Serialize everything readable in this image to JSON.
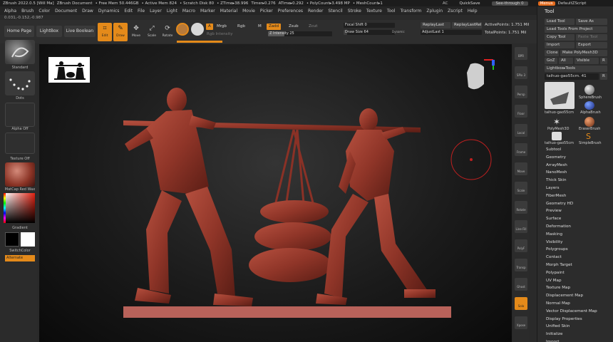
{
  "status_bar": {
    "app": "ZBrush 2022.0.5 [Will Ma]",
    "document": "ZBrush Document",
    "free_mem": "• Free Mem 50.446GB",
    "active_mem": "• Active Mem 824",
    "scratch_disk": "• Scratch Disk 80",
    "ztime": "• ZTime▸38.996",
    "timer": "Timer▸0.276",
    "atime": "ATime▸0.292",
    "polycount": "• PolyCount▸3.498 MP",
    "meshcount": "• MeshCount▸1",
    "ac": "AC",
    "quicksave": "QuickSave",
    "see_through": "See-through 0",
    "menus": "Menus",
    "default_zscript": "DefaultZScript"
  },
  "menu_bar": [
    "Alpha",
    "Brush",
    "Color",
    "Document",
    "Draw",
    "Dynamics",
    "Edit",
    "File",
    "Layer",
    "Light",
    "Macro",
    "Marker",
    "Material",
    "Movie",
    "Picker",
    "Preferences",
    "Render",
    "Stencil",
    "Stroke",
    "Texture",
    "Tool",
    "Transform",
    "Zplugin",
    "Zscript",
    "Help"
  ],
  "coords": "0.031,-0.152,-0.987",
  "toolbar": {
    "home_page": "Home Page",
    "lightbox": "LightBox",
    "live_boolean": "Live Boolean",
    "edit": "Edit",
    "draw": "Draw",
    "move": "Move",
    "scale": "Scale",
    "rotate": "Rotate",
    "a": "A",
    "mrgb": "Mrgb",
    "rgb": "Rgb",
    "m": "M",
    "zadd": "Zadd",
    "zsub": "Zsub",
    "zcut": "Zcut",
    "rgb_intensity": "Rgb Intensity",
    "z_intensity_label": "Z Intensity",
    "z_intensity": 25,
    "focal_shift_label": "Focal Shift",
    "focal_shift": 0,
    "draw_size_label": "Draw Size",
    "draw_size": 64,
    "dynamic": "Dynamic",
    "replay_last": "ReplayLast",
    "replay_last_rel": "ReplayLastRel",
    "adjust_last_label": "AdjustLast",
    "adjust_last": 1,
    "active_points": "ActivePoints: 1.751 Mil",
    "total_points": "TotalPoints: 1.751 Mil"
  },
  "left_shelf": {
    "brush": "Standard",
    "stroke": "Dots",
    "alpha": "Alpha Off",
    "texture": "Texture Off",
    "material": "MatCap Red Wax",
    "gradient": "Gradient",
    "switch_color": "SwitchColor",
    "alternate": "Alternate"
  },
  "right_column": [
    "BPR",
    "SPix 3",
    "Persp",
    "Floor",
    "Local",
    "Frame",
    "Move",
    "Scale",
    "Rotate",
    "Line Fill",
    "PolyF",
    "Transp",
    "Ghost",
    "Solo",
    "Xpose"
  ],
  "tool_panel": {
    "title": "Tool",
    "load_tool": "Load Tool",
    "save_as": "Save As",
    "load_from_project": "Load Tools From Project",
    "copy_tool": "Copy Tool",
    "paste_tool": "Paste Tool",
    "import": "Import",
    "export": "Export",
    "clone": "Clone",
    "make_polymesh": "Make PolyMesh3D",
    "goz": "GoZ",
    "all": "All",
    "visible": "Visible",
    "r": "R",
    "lightbox_tools": "Lightbox▸Tools",
    "current_tool": "taihuo-gao55cm. 41",
    "r2": "R",
    "thumbs": [
      "taihuo-gao55cm",
      "SphereBrush",
      "AlphaBrush",
      "PolyMesh3D",
      "EraserBrush",
      "taihuo-gao55cm",
      "SimpleBrush"
    ],
    "sections": [
      "Subtool",
      "Geometry",
      "ArrayMesh",
      "NanoMesh",
      "Thick Skin",
      "Layers",
      "FiberMesh",
      "Geometry HD",
      "Preview",
      "Surface",
      "Deformation",
      "Masking",
      "Visibility",
      "Polygroups",
      "Contact",
      "Morph Target",
      "Polypaint",
      "UV Map",
      "Texture Map",
      "Displacement Map",
      "Normal Map",
      "Vector Displacement Map",
      "Display Properties",
      "Unified Skin",
      "Initialize",
      "Import"
    ]
  },
  "colors": {
    "accent": "#e48a1a",
    "model": "#9a3b2e",
    "background_dark": "#0a0a0a"
  }
}
